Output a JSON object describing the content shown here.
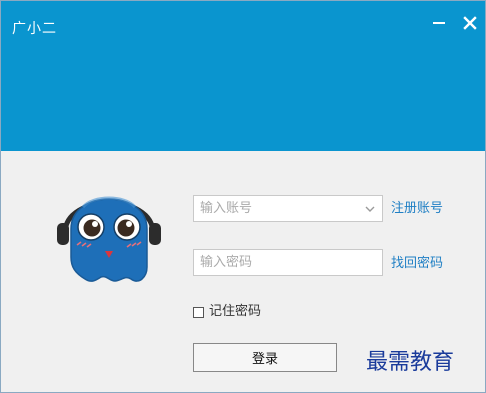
{
  "window": {
    "title": "广小二",
    "minimize_icon": "minimize-icon",
    "close_icon": "close-icon"
  },
  "login": {
    "account_placeholder": "输入账号",
    "password_placeholder": "输入密码",
    "register_link": "注册账号",
    "find_password_link": "找回密码",
    "remember_label": "记住密码",
    "remember_checked": false,
    "login_button": "登录"
  },
  "watermark": {
    "text": "最需教育"
  },
  "colors": {
    "header": "#0a95cf",
    "link": "#1f7fc4",
    "body": "#f0f0f0"
  }
}
